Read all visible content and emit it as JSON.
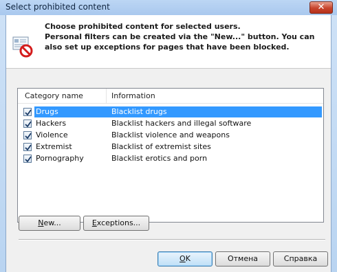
{
  "window": {
    "title": "Select prohibited content",
    "close_label": "✕"
  },
  "header": {
    "line1": "Choose prohibited content for selected users.",
    "line2": "Personal filters can be created via the \"New...\" button. You can",
    "line3": "also set up exceptions for pages that have been blocked."
  },
  "list": {
    "columns": [
      "Category name",
      "Information"
    ],
    "rows": [
      {
        "name": "Drugs",
        "info": "Blacklist drugs",
        "checked": true,
        "selected": true
      },
      {
        "name": "Hackers",
        "info": "Blacklist hackers and illegal software",
        "checked": true,
        "selected": false
      },
      {
        "name": "Violence",
        "info": "Blacklist violence and weapons",
        "checked": true,
        "selected": false
      },
      {
        "name": "Extremist",
        "info": "Blacklist of extremist sites",
        "checked": true,
        "selected": false
      },
      {
        "name": "Pornography",
        "info": "Blacklist erotics and porn",
        "checked": true,
        "selected": false
      }
    ]
  },
  "buttons": {
    "new_rest": "ew...",
    "new_key": "N",
    "exceptions_key": "E",
    "exceptions_rest": "xceptions...",
    "ok_key": "O",
    "ok_rest": "K",
    "cancel": "Отмена",
    "help": "Справка"
  },
  "colors": {
    "selection": "#3399ff",
    "titlebar": "#bcd6f4",
    "close": "#c8452d"
  },
  "icons": {
    "header": "prohibited-document-icon",
    "checkbox": "checkmark-icon"
  }
}
